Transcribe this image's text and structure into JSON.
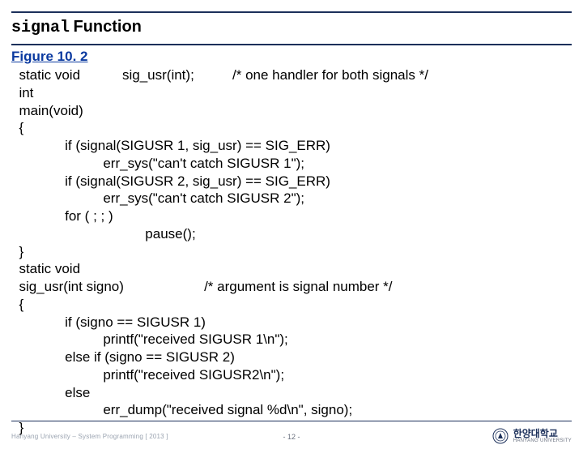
{
  "title": {
    "mono": "signal",
    "word": "Function"
  },
  "figure_link": "Figure 10. 2",
  "code": {
    "l01": "  static void           sig_usr(int);          /* one handler for both signals */",
    "l02": "  int",
    "l03": "  main(void)",
    "l04": "  {",
    "l05": "              if (signal(SIGUSR 1, sig_usr) == SIG_ERR)",
    "l06": "                        err_sys(\"can't catch SIGUSR 1\");",
    "l07": "              if (signal(SIGUSR 2, sig_usr) == SIG_ERR)",
    "l08": "                        err_sys(\"can't catch SIGUSR 2\");",
    "l09": "              for ( ; ; )",
    "l10": "                                   pause();",
    "l11": "  }",
    "l12": "  static void",
    "l13": "  sig_usr(int signo)                     /* argument is signal number */",
    "l14": "  {",
    "l15": "              if (signo == SIGUSR 1)",
    "l16": "                        printf(\"received SIGUSR 1\\n\");",
    "l17": "              else if (signo == SIGUSR 2)",
    "l18": "                        printf(\"received SIGUSR2\\n\");",
    "l19": "              else",
    "l20": "                        err_dump(\"received signal %d\\n\", signo);",
    "l21": "  }"
  },
  "footer": {
    "credit": "Hanyang University – System Programming  [ 2013 ]",
    "page": "- 12 -",
    "brand_kr": "한양대학교",
    "brand_en": "HANYANG UNIVERSITY"
  },
  "colors": {
    "rule": "#1b2f5a",
    "link": "#0b3aa0"
  }
}
